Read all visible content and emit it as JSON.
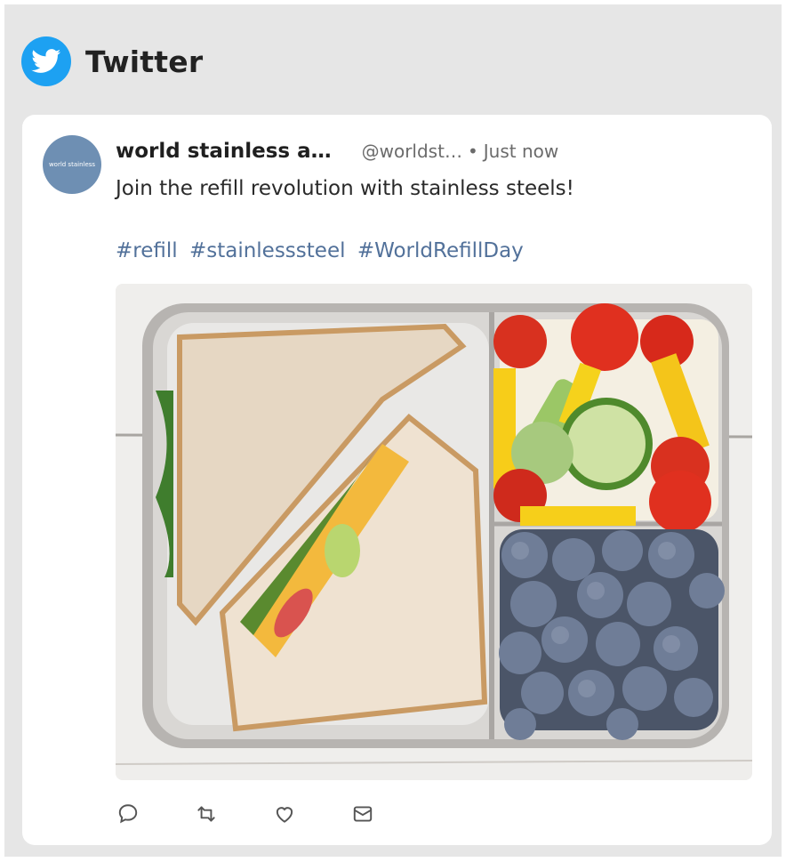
{
  "widget": {
    "title": "Twitter",
    "logo_icon": "twitter-bird-icon",
    "brand_color": "#1da1f2"
  },
  "tweet": {
    "author": "world stainless a…",
    "handle": "@worldst…",
    "separator": "•",
    "time": "Just now",
    "text": "Join the refill revolution with stainless steels!",
    "hashtags": [
      "#refill",
      "#stainlesssteel",
      "#WorldRefillDay"
    ],
    "avatar_text": "world stainless",
    "hashtag_color": "#52719a",
    "image": "lunchbox-photo"
  },
  "actions": [
    {
      "name": "reply",
      "icon": "comment-icon"
    },
    {
      "name": "retweet",
      "icon": "retweet-icon"
    },
    {
      "name": "like",
      "icon": "heart-icon"
    },
    {
      "name": "share",
      "icon": "mail-icon"
    }
  ]
}
